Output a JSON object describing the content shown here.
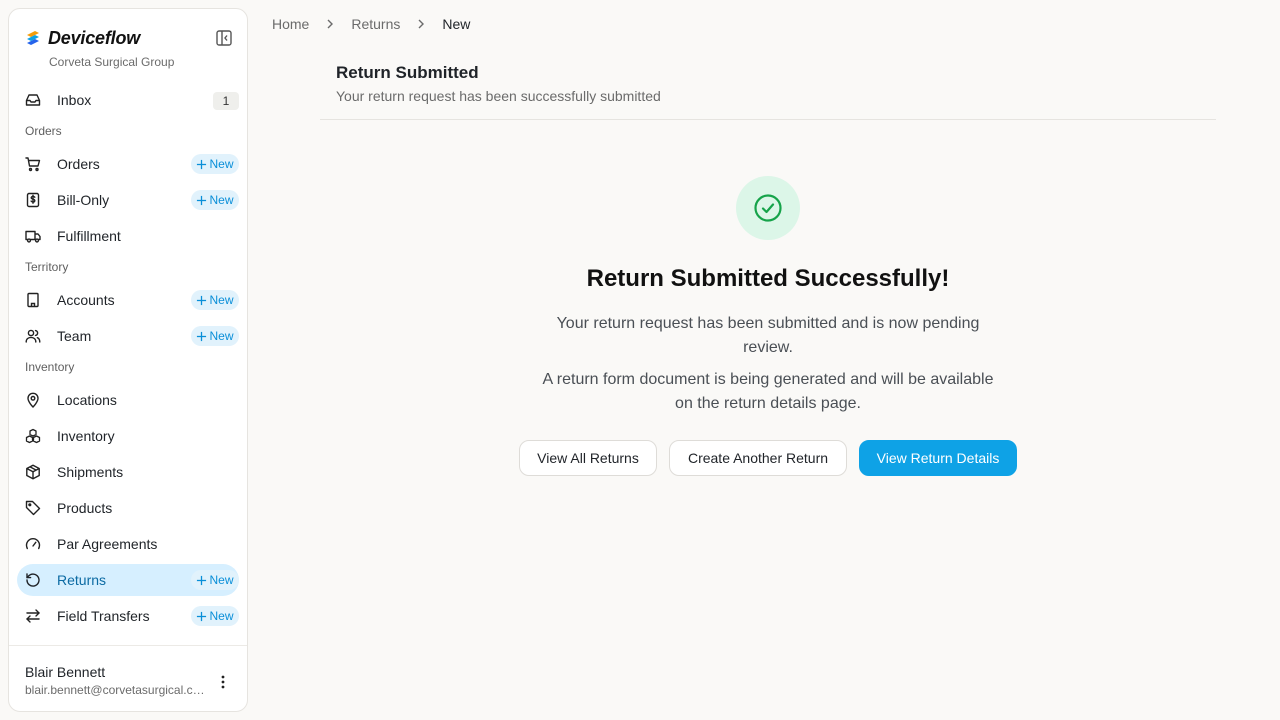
{
  "brand": {
    "name": "Deviceflow",
    "org": "Corveta Surgical Group"
  },
  "nav": {
    "inbox": {
      "label": "Inbox",
      "count": "1"
    },
    "new_label": "New",
    "sections": {
      "orders": "Orders",
      "territory": "Territory",
      "inventory": "Inventory"
    },
    "items": {
      "orders": "Orders",
      "bill_only": "Bill-Only",
      "fulfillment": "Fulfillment",
      "accounts": "Accounts",
      "team": "Team",
      "locations": "Locations",
      "inventory": "Inventory",
      "shipments": "Shipments",
      "products": "Products",
      "par_agreements": "Par Agreements",
      "returns": "Returns",
      "field_transfers": "Field Transfers"
    },
    "active": "returns"
  },
  "user": {
    "name": "Blair Bennett",
    "email": "blair.bennett@corvetasurgical.com"
  },
  "breadcrumb": [
    "Home",
    "Returns",
    "New"
  ],
  "header": {
    "title": "Return Submitted",
    "subtitle": "Your return request has been successfully submitted"
  },
  "success": {
    "title": "Return Submitted Successfully!",
    "message1": "Your return request has been submitted and is now pending review.",
    "message2": "A return form document is being generated and will be available on the return details page."
  },
  "actions": {
    "view_all": "View All Returns",
    "create_another": "Create Another Return",
    "view_details": "View Return Details"
  },
  "colors": {
    "accent": "#0ea2e6",
    "active_bg": "#d6efff",
    "success_bg": "#dcf6e8",
    "success_icon": "#16a34a"
  },
  "icons": {
    "brand": "deviceflow-logo",
    "collapse": "sidebar-collapse-icon",
    "inbox": "inbox-icon",
    "orders": "cart-icon",
    "bill_only": "receipt-dollar-icon",
    "fulfillment": "truck-icon",
    "accounts": "building-icon",
    "team": "users-icon",
    "locations": "map-pin-icon",
    "inventory": "boxes-icon",
    "shipments": "package-icon",
    "products": "tag-icon",
    "par_agreements": "gauge-icon",
    "returns": "rotate-ccw-icon",
    "field_transfers": "arrows-left-right-icon",
    "user_menu": "more-vertical-icon",
    "success": "check-circle-icon"
  }
}
